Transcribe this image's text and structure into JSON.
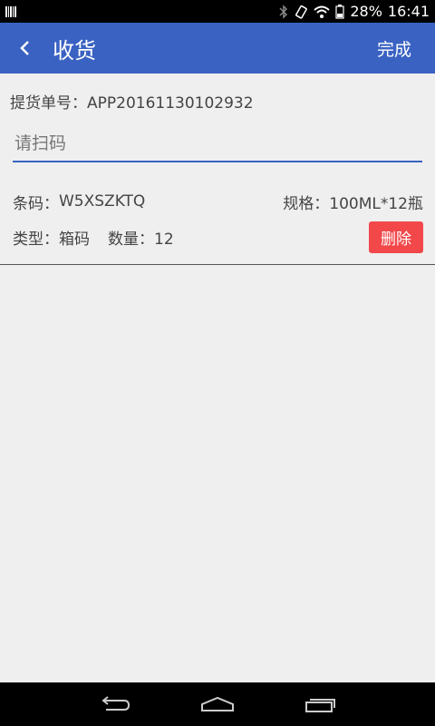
{
  "status_bar": {
    "battery": "28%",
    "time": "16:41"
  },
  "app_bar": {
    "title": "收货",
    "done_label": "完成"
  },
  "order": {
    "label": "提货单号：",
    "number": "APP20161130102932"
  },
  "scan": {
    "placeholder": "请扫码",
    "value": ""
  },
  "items": [
    {
      "barcode_label": "条码：",
      "barcode": "W5XSZKTQ",
      "spec_label": "规格：",
      "spec": "100ML*12瓶",
      "type_label": "类型：",
      "type": "箱码",
      "qty_label": "数量：",
      "qty": "12",
      "delete_label": "删除"
    }
  ],
  "colors": {
    "primary": "#3a62c3",
    "danger": "#f2484a",
    "background": "#efefef"
  },
  "icons": {
    "back": "chevron-left-icon",
    "nav_back": "back-arrow-icon",
    "nav_home": "home-icon",
    "nav_recents": "recents-icon"
  }
}
